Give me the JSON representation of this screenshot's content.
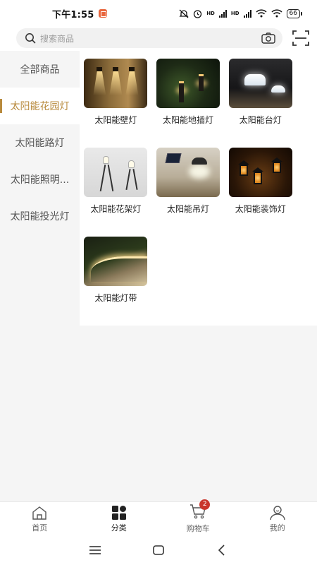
{
  "status_bar": {
    "time": "下午1:55",
    "battery": "66",
    "hd1": "HD",
    "hd2": "HD"
  },
  "search": {
    "placeholder": "搜索商品",
    "icon": "search-icon",
    "camera_icon": "camera-icon",
    "scan_icon": "scan-icon"
  },
  "sidebar": {
    "items": [
      {
        "label": "全部商品",
        "active": false
      },
      {
        "label": "太阳能花园灯",
        "active": true
      },
      {
        "label": "太阳能路灯",
        "active": false
      },
      {
        "label": "太阳能照明...",
        "active": false
      },
      {
        "label": "太阳能投光灯",
        "active": false
      }
    ]
  },
  "categories": {
    "items": [
      {
        "label": "太阳能壁灯",
        "image": "wall-light-photo"
      },
      {
        "label": "太阳能地插灯",
        "image": "ground-stake-light-photo"
      },
      {
        "label": "太阳能台灯",
        "image": "table-lamp-photo"
      },
      {
        "label": "太阳能花架灯",
        "image": "tripod-light-photo"
      },
      {
        "label": "太阳能吊灯",
        "image": "pendant-light-photo"
      },
      {
        "label": "太阳能装饰灯",
        "image": "lantern-light-photo"
      },
      {
        "label": "太阳能灯带",
        "image": "light-strip-photo"
      }
    ]
  },
  "bottom_nav": {
    "items": [
      {
        "label": "首页",
        "icon": "home-icon",
        "active": false
      },
      {
        "label": "分类",
        "icon": "category-icon",
        "active": true
      },
      {
        "label": "购物车",
        "icon": "cart-icon",
        "active": false,
        "badge": "2"
      },
      {
        "label": "我的",
        "icon": "profile-icon",
        "active": false
      }
    ]
  },
  "colors": {
    "accent": "#b88a3c",
    "badge": "#c9362c",
    "sidebar_bg": "#f5f5f5"
  }
}
